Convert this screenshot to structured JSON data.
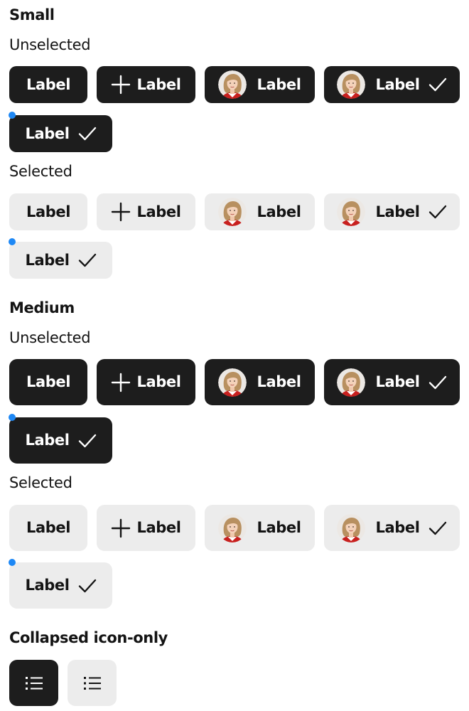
{
  "sections": {
    "small": {
      "title": "Small",
      "unselected": "Unselected",
      "selected": "Selected"
    },
    "medium": {
      "title": "Medium",
      "unselected": "Unselected",
      "selected": "Selected"
    },
    "collapsed": {
      "title": "Collapsed icon-only"
    }
  },
  "chip": {
    "label": "Label"
  },
  "icons": {
    "add": "plus-icon",
    "selected_mark": "check-icon",
    "avatar": "user-avatar",
    "collapsed": "list-icon"
  },
  "colors": {
    "unselected_bg": "#1d1d1d",
    "unselected_text": "#ffffff",
    "selected_bg": "#ececec",
    "selected_text": "#141414",
    "focus_indicator": "#1e88f5"
  }
}
